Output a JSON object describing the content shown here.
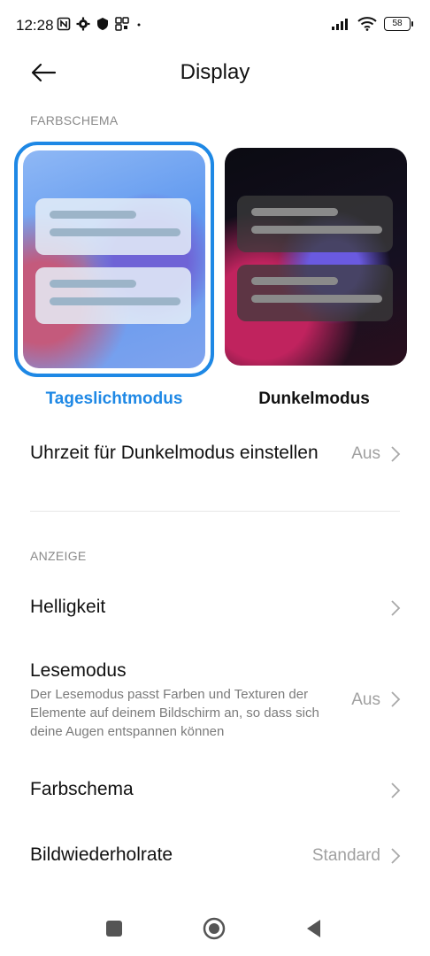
{
  "status_bar": {
    "time": "12:28",
    "battery": "58"
  },
  "header": {
    "title": "Display"
  },
  "color_scheme_section": {
    "label": "FARBSCHEMA",
    "light_mode_label": "Tageslichtmodus",
    "dark_mode_label": "Dunkelmodus",
    "selected": "light",
    "accent_color": "#1e88e5"
  },
  "dark_schedule": {
    "title": "Uhrzeit für Dunkelmodus einstellen",
    "value": "Aus"
  },
  "display_section": {
    "label": "ANZEIGE",
    "items": [
      {
        "title": "Helligkeit",
        "value": ""
      },
      {
        "title": "Lesemodus",
        "description": "Der Lesemodus passt Farben und Texturen der Elemente auf deinem Bildschirm an, so dass sich deine Augen entspannen können",
        "value": "Aus"
      },
      {
        "title": "Farbschema",
        "value": ""
      },
      {
        "title": "Bildwiederholrate",
        "value": "Standard"
      }
    ]
  },
  "icons": {
    "back": "arrow-left-icon",
    "chevron": "chevron-right-icon",
    "nav_recents": "square-icon",
    "nav_home": "circle-icon",
    "nav_back": "triangle-back-icon"
  }
}
